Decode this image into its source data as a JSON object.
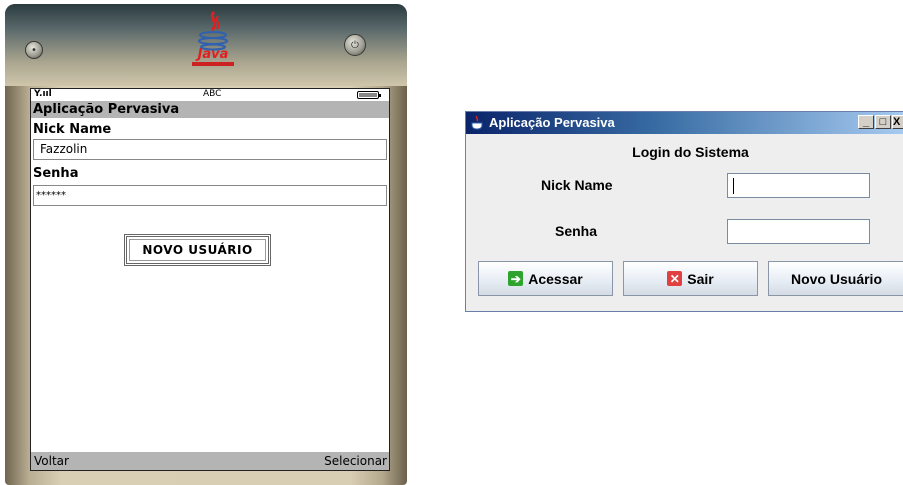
{
  "emulator": {
    "brand": "Java",
    "status": {
      "signal": "Y.ııl",
      "input_mode": "ABC"
    },
    "title": "Aplicação Pervasiva",
    "form": {
      "nick_label": "Nick Name",
      "nick_value": "Fazzolin",
      "senha_label": "Senha",
      "senha_value": "******"
    },
    "button_label": "NOVO USUÁRIO",
    "softkeys": {
      "left": "Voltar",
      "right": "Selecionar"
    }
  },
  "window": {
    "title": "Aplicação Pervasiva",
    "controls": {
      "minimize": "_",
      "maximize": "□",
      "close": "X"
    },
    "heading": "Login do Sistema",
    "nick_label": "Nick Name",
    "nick_value": "",
    "senha_label": "Senha",
    "senha_value": "",
    "buttons": {
      "acessar": "Acessar",
      "sair": "Sair",
      "novo_usuario": "Novo Usuário"
    }
  },
  "icons": {
    "java_logo": "java-coffee-cup-icon",
    "acessar": "arrow-right-icon",
    "sair": "close-x-icon"
  },
  "colors": {
    "title_gradient_start": "#0a246a",
    "title_gradient_end": "#a6caf0",
    "emulator_bar": "#b4b4b4",
    "acessar_icon": "#2ea32e",
    "sair_icon": "#e04040",
    "java_red": "#e02020"
  }
}
